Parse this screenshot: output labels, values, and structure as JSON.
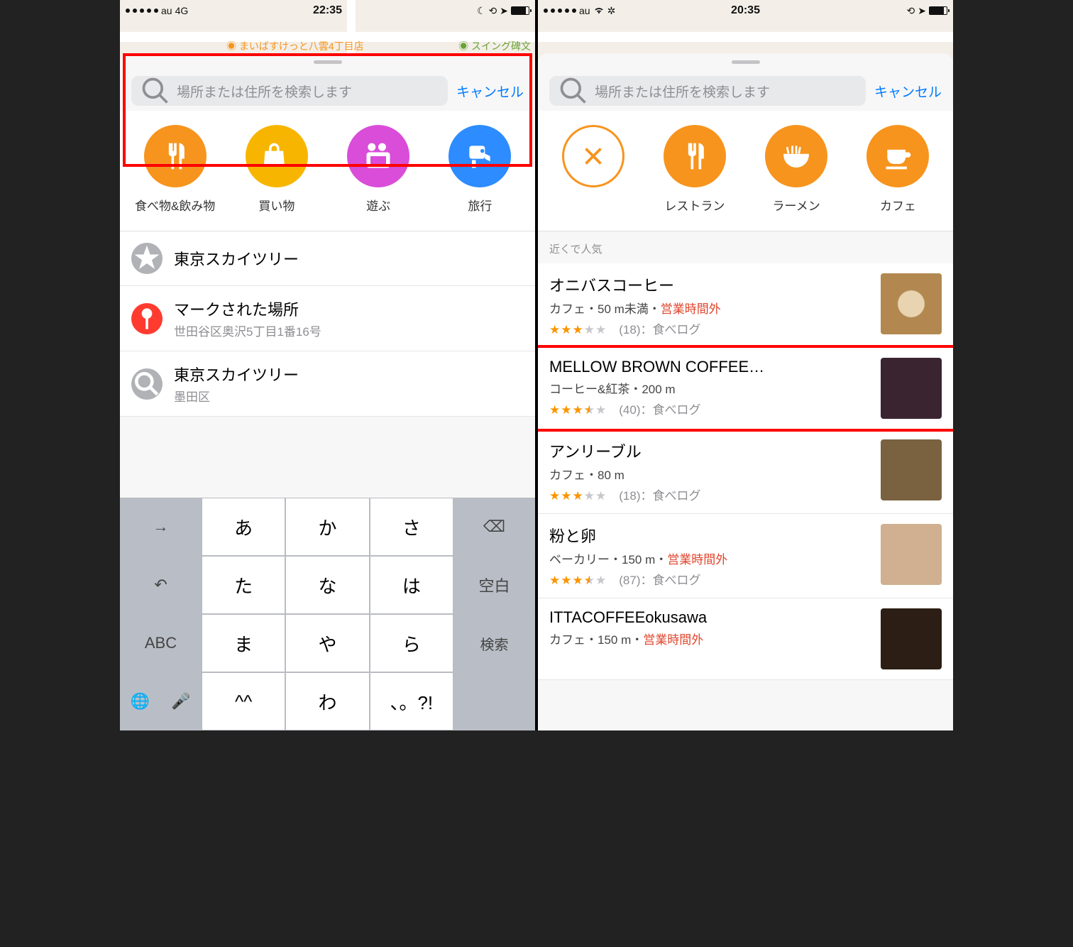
{
  "left": {
    "status": {
      "carrier": "au",
      "net": "4G",
      "time": "22:35"
    },
    "search_placeholder": "場所または住所を検索します",
    "cancel": "キャンセル",
    "map_labels": [
      "まいばすけっと八雲4丁目店",
      "スイング碑文"
    ],
    "categories": [
      {
        "key": "food",
        "label": "食べ物&飲み物",
        "color": "orange"
      },
      {
        "key": "shopping",
        "label": "買い物",
        "color": "yellow"
      },
      {
        "key": "play",
        "label": "遊ぶ",
        "color": "magenta"
      },
      {
        "key": "travel",
        "label": "旅行",
        "color": "blue"
      }
    ],
    "history": [
      {
        "icon": "star",
        "icon_bg": "#b0b2b6",
        "title": "東京スカイツリー",
        "sub": ""
      },
      {
        "icon": "pin",
        "icon_bg": "#ff3b30",
        "title": "マークされた場所",
        "sub": "世田谷区奥沢5丁目1番16号"
      },
      {
        "icon": "search",
        "icon_bg": "#b0b2b6",
        "title": "東京スカイツリー",
        "sub": "墨田区"
      }
    ],
    "keyboard": {
      "rows": [
        [
          "→",
          "あ",
          "か",
          "さ",
          "⌫"
        ],
        [
          "↶",
          "た",
          "な",
          "は",
          "空白"
        ],
        [
          "ABC",
          "ま",
          "や",
          "ら",
          "検索"
        ],
        [
          "",
          "^^",
          "わ",
          "、。?!",
          ""
        ]
      ],
      "bottom": [
        "🌐",
        "🎤"
      ]
    }
  },
  "right": {
    "status": {
      "carrier": "au",
      "time": "20:35"
    },
    "search_placeholder": "場所または住所を検索します",
    "cancel": "キャンセル",
    "categories": [
      {
        "key": "close",
        "label": "",
        "color": "outline"
      },
      {
        "key": "restaurant",
        "label": "レストラン",
        "color": "orange"
      },
      {
        "key": "ramen",
        "label": "ラーメン",
        "color": "orange"
      },
      {
        "key": "cafe",
        "label": "カフェ",
        "color": "orange"
      }
    ],
    "section_header": "近くで人気",
    "results": [
      {
        "name": "オニバスコーヒー",
        "meta_pre": "カフェ・50 m未満・",
        "meta_red": "営業時間外",
        "stars": 3.0,
        "count": 18,
        "source": "食べログ",
        "thumb": "#c9a478"
      },
      {
        "name": "MELLOW BROWN COFFEE…",
        "meta_pre": "コーヒー&紅茶・200 m",
        "meta_red": "",
        "stars": 3.5,
        "count": 40,
        "source": "食べログ",
        "thumb": "#3a2430"
      },
      {
        "name": "アンリーブル",
        "meta_pre": "カフェ・80 m",
        "meta_red": "",
        "stars": 3.0,
        "count": 18,
        "source": "食べログ",
        "thumb": "#7a6240"
      },
      {
        "name": "粉と卵",
        "meta_pre": "ベーカリー・150 m・",
        "meta_red": "営業時間外",
        "stars": 3.5,
        "count": 87,
        "source": "食べログ",
        "thumb": "#d0b090"
      },
      {
        "name": "ITTACOFFEEokusawa",
        "meta_pre": "カフェ・150 m・",
        "meta_red": "営業時間外",
        "stars": 0,
        "count": 0,
        "source": "",
        "thumb": "#2c1e14"
      }
    ]
  }
}
